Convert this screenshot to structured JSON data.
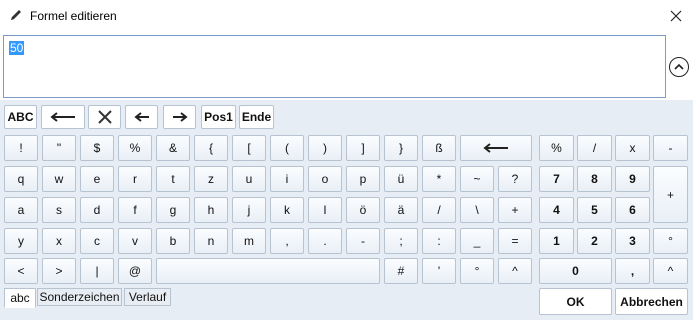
{
  "window": {
    "title": "Formel editieren"
  },
  "formula": {
    "value": "50"
  },
  "toolbar": {
    "abc": "ABC",
    "pos1": "Pos1",
    "ende": "Ende"
  },
  "rows": {
    "r1": [
      "!",
      "\"",
      "$",
      "%",
      "&",
      "{",
      "[",
      "(",
      ")",
      "]",
      "}",
      "ß"
    ],
    "r2": [
      "q",
      "w",
      "e",
      "r",
      "t",
      "z",
      "u",
      "i",
      "o",
      "p",
      "ü",
      "*",
      "~",
      "?"
    ],
    "r3": [
      "a",
      "s",
      "d",
      "f",
      "g",
      "h",
      "j",
      "k",
      "l",
      "ö",
      "ä",
      "/",
      "\\",
      "+"
    ],
    "r4": [
      "y",
      "x",
      "c",
      "v",
      "b",
      "n",
      "m",
      ",",
      ".",
      "-",
      ";",
      ":",
      "_",
      "="
    ],
    "r5": [
      "<",
      ">",
      "|",
      "@",
      "#",
      "'",
      "°",
      "^"
    ]
  },
  "numpad": {
    "r1": [
      "%",
      "/",
      "x",
      "-"
    ],
    "r2": [
      "7",
      "8",
      "9"
    ],
    "r3": [
      "4",
      "5",
      "6"
    ],
    "r4": [
      "1",
      "2",
      "3",
      "°"
    ],
    "r5": [
      "0",
      ",",
      "^"
    ],
    "plus": "+"
  },
  "tabs": [
    "abc",
    "Sonderzeichen",
    "Verlauf"
  ],
  "buttons": {
    "ok": "OK",
    "cancel": "Abbrechen"
  }
}
